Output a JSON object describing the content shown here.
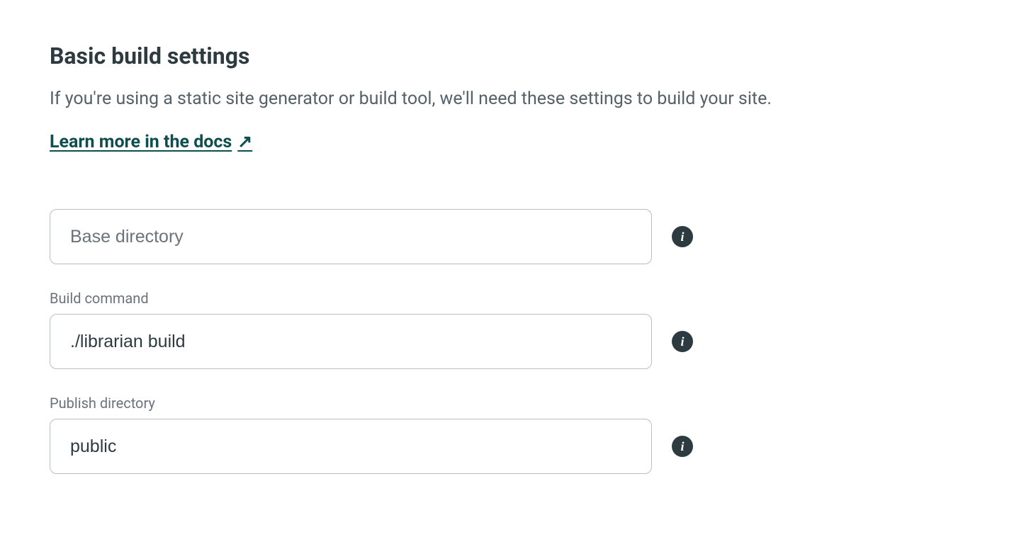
{
  "section": {
    "title": "Basic build settings",
    "description": "If you're using a static site generator or build tool, we'll need these settings to build your site.",
    "docs_link_text": "Learn more in the docs",
    "docs_link_arrow": "↗"
  },
  "fields": {
    "base_directory": {
      "placeholder": "Base directory",
      "value": ""
    },
    "build_command": {
      "label": "Build command",
      "value": "./librarian build"
    },
    "publish_directory": {
      "label": "Publish directory",
      "value": "public"
    }
  },
  "info_glyph": "i"
}
